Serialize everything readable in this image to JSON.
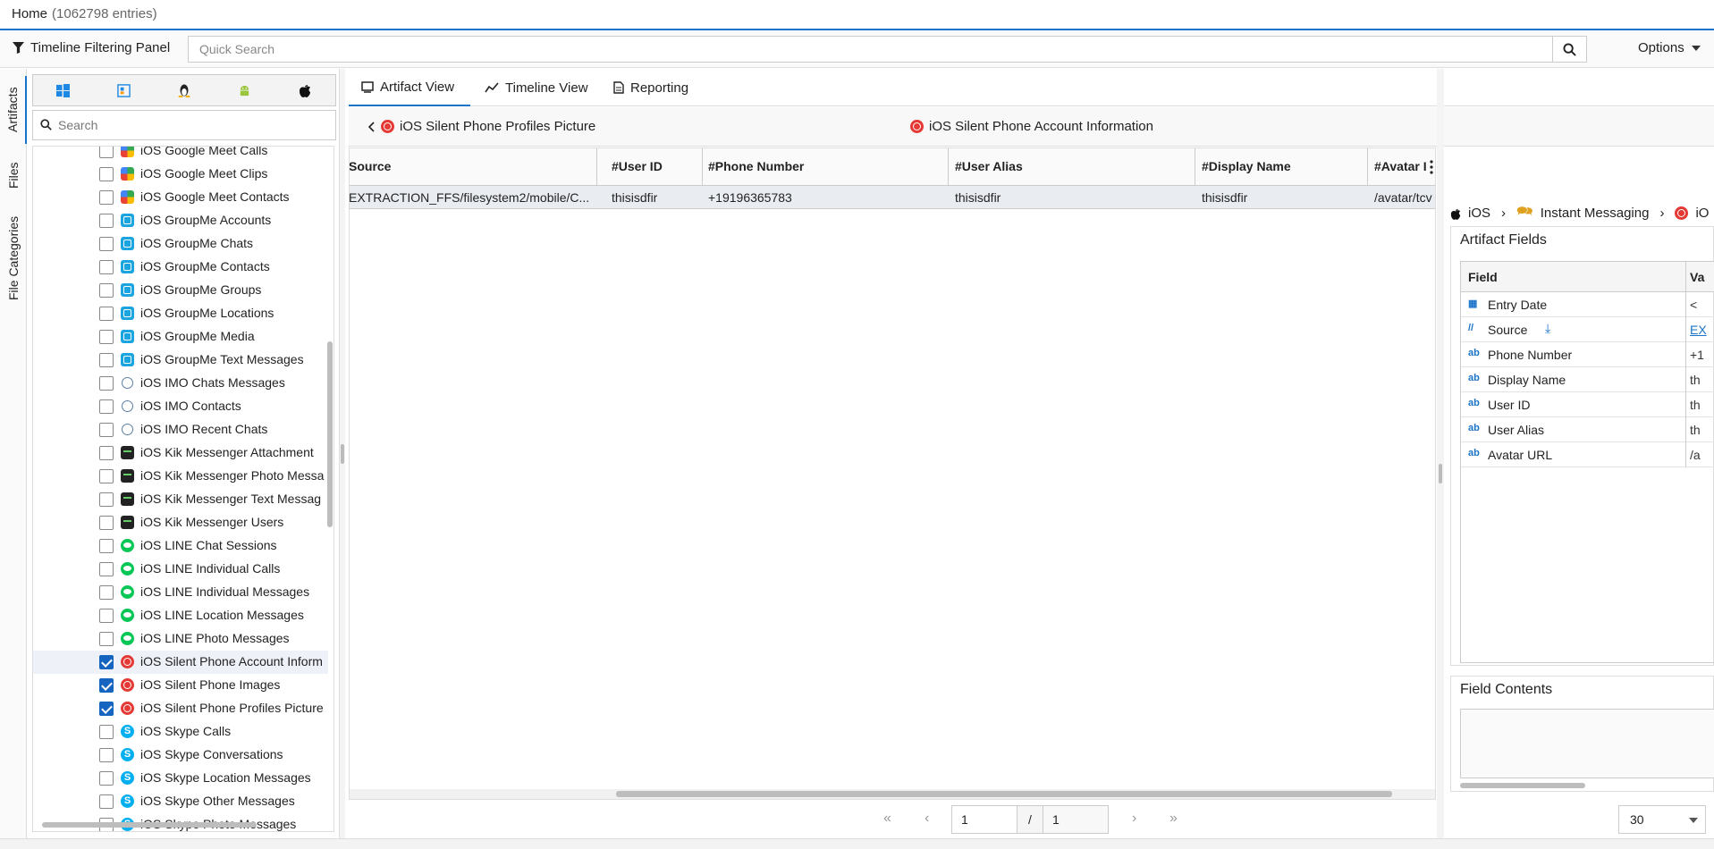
{
  "home_tab": {
    "label": "Home",
    "count": "(1062798 entries)"
  },
  "toolbar": {
    "filter_panel_label": "Timeline Filtering Panel",
    "quick_search_placeholder": "Quick Search",
    "options_label": "Options"
  },
  "side_tabs": [
    "Artifacts",
    "Files",
    "File Categories"
  ],
  "left_panel": {
    "search_placeholder": "Search",
    "os_icons": [
      "windows-icon",
      "windows-old-icon",
      "linux-icon",
      "android-icon",
      "apple-icon"
    ],
    "items": [
      {
        "label": "iOS Google Meet Calls",
        "icon": "gm",
        "checked": false
      },
      {
        "label": "iOS Google Meet Clips",
        "icon": "gm",
        "checked": false
      },
      {
        "label": "iOS Google Meet Contacts",
        "icon": "gm",
        "checked": false
      },
      {
        "label": "iOS GroupMe Accounts",
        "icon": "grp",
        "checked": false
      },
      {
        "label": "iOS GroupMe Chats",
        "icon": "grp",
        "checked": false
      },
      {
        "label": "iOS GroupMe Contacts",
        "icon": "grp",
        "checked": false
      },
      {
        "label": "iOS GroupMe Groups",
        "icon": "grp",
        "checked": false
      },
      {
        "label": "iOS GroupMe Locations",
        "icon": "grp",
        "checked": false
      },
      {
        "label": "iOS GroupMe Media",
        "icon": "grp",
        "checked": false
      },
      {
        "label": "iOS GroupMe Text Messages",
        "icon": "grp",
        "checked": false
      },
      {
        "label": "iOS IMO Chats Messages",
        "icon": "imo",
        "checked": false
      },
      {
        "label": "iOS IMO Contacts",
        "icon": "imo",
        "checked": false
      },
      {
        "label": "iOS IMO Recent Chats",
        "icon": "imo",
        "checked": false
      },
      {
        "label": "iOS Kik Messenger Attachment",
        "icon": "kik",
        "checked": false
      },
      {
        "label": "iOS Kik Messenger Photo Messa",
        "icon": "kik",
        "checked": false
      },
      {
        "label": "iOS Kik Messenger Text Messag",
        "icon": "kik",
        "checked": false
      },
      {
        "label": "iOS Kik Messenger Users",
        "icon": "kik",
        "checked": false
      },
      {
        "label": "iOS LINE Chat Sessions",
        "icon": "line",
        "checked": false
      },
      {
        "label": "iOS LINE Individual Calls",
        "icon": "line",
        "checked": false
      },
      {
        "label": "iOS LINE Individual Messages",
        "icon": "line",
        "checked": false
      },
      {
        "label": "iOS LINE Location Messages",
        "icon": "line",
        "checked": false
      },
      {
        "label": "iOS LINE Photo Messages",
        "icon": "line",
        "checked": false
      },
      {
        "label": "iOS Silent Phone Account Inform",
        "icon": "sp",
        "checked": true,
        "selected": true
      },
      {
        "label": "iOS Silent Phone Images",
        "icon": "sp",
        "checked": true
      },
      {
        "label": "iOS Silent Phone Profiles Picture",
        "icon": "sp",
        "checked": true
      },
      {
        "label": "iOS Skype Calls",
        "icon": "sky",
        "checked": false
      },
      {
        "label": "iOS Skype Conversations",
        "icon": "sky",
        "checked": false
      },
      {
        "label": "iOS Skype Location Messages",
        "icon": "sky",
        "checked": false
      },
      {
        "label": "iOS Skype Other Messages",
        "icon": "sky",
        "checked": false
      },
      {
        "label": "iOS Skype Photo Messages",
        "icon": "sky",
        "checked": false
      }
    ]
  },
  "main_tabs": [
    {
      "label": "Artifact View",
      "icon": "artifact-view-icon",
      "active": true
    },
    {
      "label": "Timeline View",
      "icon": "timeline-icon",
      "active": false
    },
    {
      "label": "Reporting",
      "icon": "report-icon",
      "active": false
    }
  ],
  "breadcrumb": {
    "back_label": "iOS Silent Phone Profiles Picture",
    "current_label": "iOS Silent Phone Account Information"
  },
  "grid": {
    "columns": [
      "Source",
      "#User ID",
      "#Phone Number",
      "#User Alias",
      "#Display Name",
      "#Avatar I"
    ],
    "rows": [
      [
        "EXTRACTION_FFS/filesystem2/mobile/C...",
        "thisisdfir",
        "+19196365783",
        "thisisdfir",
        "thisisdfir",
        "/avatar/tcv"
      ]
    ]
  },
  "detail": {
    "crumbs": [
      "iOS",
      "Instant Messaging",
      "iO"
    ],
    "artifact_fields_title": "Artifact Fields",
    "field_header": "Field",
    "value_header": "Va",
    "fields": [
      {
        "name": "Entry Date",
        "icon": "calendar-icon",
        "value": "<"
      },
      {
        "name": "Source",
        "icon": "source-icon",
        "value": "EX",
        "link": true
      },
      {
        "name": "Phone Number",
        "icon": "text-icon",
        "value": "+1"
      },
      {
        "name": "Display Name",
        "icon": "text-icon",
        "value": "th"
      },
      {
        "name": "User ID",
        "icon": "text-icon",
        "value": "th"
      },
      {
        "name": "User Alias",
        "icon": "text-icon",
        "value": "th"
      },
      {
        "name": "Avatar URL",
        "icon": "text-icon",
        "value": "/a"
      }
    ],
    "field_contents_title": "Field Contents"
  },
  "pager": {
    "page": "1",
    "separator": "/",
    "total": "1",
    "page_size": "30"
  },
  "colors": {
    "accent": "#1a73c9",
    "checkbox": "#1565c0",
    "silent_phone": "#e53935"
  }
}
